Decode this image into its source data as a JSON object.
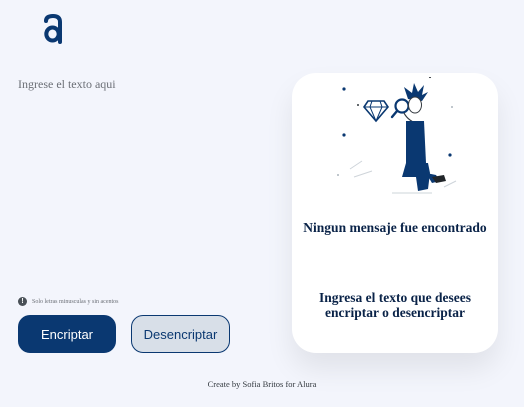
{
  "logo": {
    "icon": "alura-logo-icon",
    "color": "#0a3871"
  },
  "input": {
    "placeholder": "Ingrese el texto aqui",
    "value": ""
  },
  "hint": {
    "icon": "info-icon",
    "icon_glyph": "!",
    "text": "Solo letras minusculas y sin acentos"
  },
  "buttons": {
    "encrypt_label": "Encriptar",
    "decrypt_label": "Desencriptar"
  },
  "output_card": {
    "illustration": "person-with-magnifying-glass-and-diamond-illustration",
    "title": "Ningun mensaje fue encontrado",
    "text": "Ingresa el texto que desees encriptar o desencriptar"
  },
  "footer": {
    "text": "Create by Sofia Britos for Alura"
  },
  "colors": {
    "primary": "#0a3871",
    "secondary_bg": "#d8dfe8",
    "page_bg": "#f3f5fc"
  }
}
